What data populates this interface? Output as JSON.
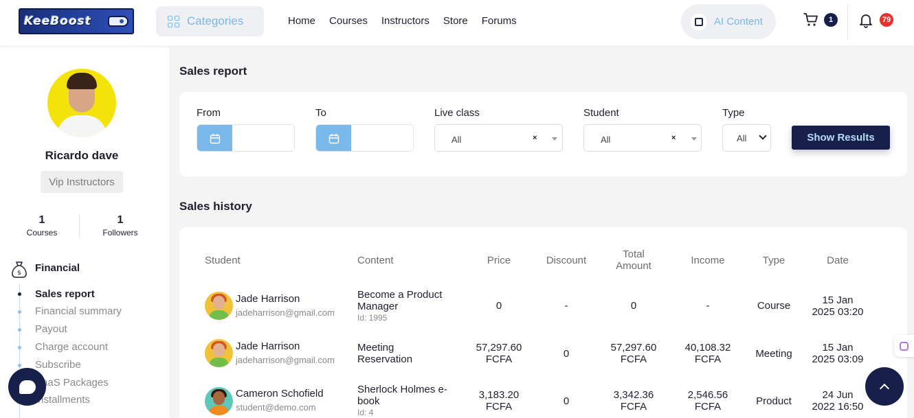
{
  "header": {
    "logo_text": "KeeBoost",
    "categories_label": "Categories",
    "nav": [
      "Home",
      "Courses",
      "Instructors",
      "Store",
      "Forums"
    ],
    "ai_label": "AI Content",
    "cart_count": "1",
    "notifications_count": "79"
  },
  "profile": {
    "name": "Ricardo dave",
    "badge": "Vip Instructors",
    "courses_count": "1",
    "courses_label": "Courses",
    "followers_count": "1",
    "followers_label": "Followers"
  },
  "sidebar": {
    "section_title": "Financial",
    "items": [
      "Sales report",
      "Financial summary",
      "Payout",
      "Charge account",
      "Subscribe",
      "SaaS Packages",
      "Installments"
    ]
  },
  "filters": {
    "title": "Sales report",
    "from_label": "From",
    "to_label": "To",
    "live_class_label": "Live class",
    "live_class_value": "All",
    "student_label": "Student",
    "student_value": "All",
    "type_label": "Type",
    "type_value": "All",
    "clear_symbol": "×",
    "submit_label": "Show Results"
  },
  "history": {
    "title": "Sales history",
    "columns": [
      "Student",
      "Content",
      "Price",
      "Discount",
      "Total\nAmount",
      "Income",
      "Type",
      "Date"
    ],
    "rows": [
      {
        "name": "Jade Harrison",
        "email": "jadeharrison@gmail.com",
        "content_l1": "Become a Product",
        "content_l2": "Manager",
        "content_id": "Id: 1995",
        "price_l1": "0",
        "price_l2": "",
        "discount": "-",
        "total_l1": "0",
        "total_l2": "",
        "income_l1": "-",
        "income_l2": "",
        "type": "Course",
        "date_l1": "15 Jan",
        "date_l2": "2025 03:20"
      },
      {
        "name": "Jade Harrison",
        "email": "jadeharrison@gmail.com",
        "content_l1": "Meeting",
        "content_l2": "Reservation",
        "content_id": "",
        "price_l1": "57,297.60",
        "price_l2": "FCFA",
        "discount": "0",
        "total_l1": "57,297.60",
        "total_l2": "FCFA",
        "income_l1": "40,108.32",
        "income_l2": "FCFA",
        "type": "Meeting",
        "date_l1": "15 Jan",
        "date_l2": "2025 03:09"
      },
      {
        "name": "Cameron Schofield",
        "email": "student@demo.com",
        "content_l1": "Sherlock Holmes e-",
        "content_l2": "book",
        "content_id": "Id: 4",
        "price_l1": "3,183.20",
        "price_l2": "FCFA",
        "discount": "0",
        "total_l1": "3,342.36",
        "total_l2": "FCFA",
        "income_l1": "2,546.56",
        "income_l2": "FCFA",
        "type": "Product",
        "date_l1": "24 Jun",
        "date_l2": "2022 16:50"
      }
    ]
  },
  "colors": {
    "primary_dark": "#16204a",
    "accent_light_blue": "#79b8e8",
    "notification_red": "#e5312f"
  },
  "icons": [
    "grid-icon",
    "ai-chip-icon",
    "cart-icon",
    "bell-icon",
    "calendar-icon",
    "money-bag-icon",
    "chat-icon",
    "chevron-up-icon"
  ]
}
